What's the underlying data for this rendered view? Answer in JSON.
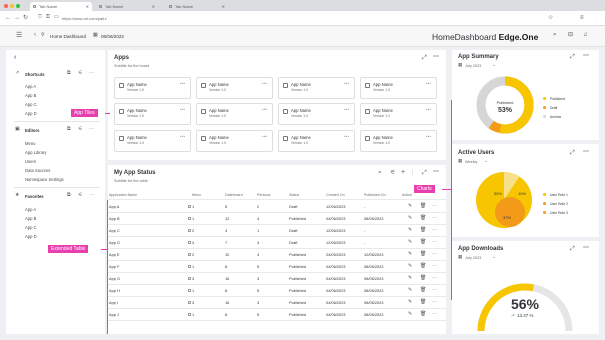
{
  "browser": {
    "tabs": [
      "Tab Name",
      "Tab Name",
      "Tab Name"
    ],
    "url": "https://www.url.com/path/"
  },
  "header": {
    "back": "Home Dashboard",
    "date": "06/06/2022",
    "brand_a": "HomeDashboard",
    "brand_b": "Edge.One"
  },
  "sidebar": {
    "shortcuts": {
      "title": "Shortcuts",
      "items": [
        "App A",
        "App B",
        "App C",
        "App D"
      ]
    },
    "editors": {
      "title": "Editors",
      "items": [
        "Menu",
        "App Library",
        "Users",
        "Data Sources",
        "Namespace Settings"
      ]
    },
    "favorites": {
      "title": "Favorites",
      "items": [
        "App A",
        "App B",
        "App C",
        "App D"
      ]
    }
  },
  "apps": {
    "title": "Apps",
    "subtitle": "Subtitle for the board",
    "tile_name": "App Name",
    "tile_version": "Version 1.0"
  },
  "status": {
    "title": "My App Status",
    "subtitle": "Subtitle for the table",
    "columns": [
      "Application Name",
      "Menu",
      "Dashboard",
      "Persona",
      "Status",
      "Created On",
      "Published On",
      "Action"
    ],
    "rows": [
      [
        "App A",
        "1",
        "5",
        "2",
        "Draft",
        "12/06/2023",
        "-"
      ],
      [
        "App B",
        "1",
        "12",
        "4",
        "Published",
        "04/06/2023",
        "08/06/2023"
      ],
      [
        "App C",
        "2",
        "4",
        "1",
        "Draft",
        "12/06/2023",
        "-"
      ],
      [
        "App D",
        "3",
        "7",
        "3",
        "Draft",
        "12/06/2023",
        "-"
      ],
      [
        "App E",
        "2",
        "10",
        "4",
        "Published",
        "24/05/2023",
        "12/06/2023"
      ],
      [
        "App F",
        "1",
        "8",
        "5",
        "Published",
        "04/06/2023",
        "08/06/2023"
      ],
      [
        "App G",
        "3",
        "16",
        "3",
        "Published",
        "04/06/2023",
        "08/06/2023"
      ],
      [
        "App H",
        "1",
        "8",
        "5",
        "Published",
        "04/06/2023",
        "08/06/2023"
      ],
      [
        "App I",
        "3",
        "16",
        "3",
        "Published",
        "04/06/2023",
        "08/06/2023"
      ],
      [
        "App J",
        "1",
        "8",
        "5",
        "Published",
        "04/06/2023",
        "08/06/2023"
      ]
    ]
  },
  "summary": {
    "title": "App Summary",
    "period": "July 2023",
    "center_label": "Published",
    "center_value": "53%",
    "legend": [
      "Published",
      "Draft",
      "Archive"
    ]
  },
  "active": {
    "title": "Active Users",
    "period": "Weekly",
    "labels": [
      "55%",
      "10%",
      "37%"
    ],
    "legend": [
      "User Role 1",
      "User Role 2",
      "User Role 3"
    ]
  },
  "downloads": {
    "title": "App Downloads",
    "period": "July 2023",
    "value": "56%",
    "delta": "13.37 %",
    "fraction": 0.56
  },
  "callouts": {
    "tiles": "App Tiles",
    "charts": "Charts",
    "table": "Extended Table"
  },
  "colors": {
    "yellow": "#f7c600",
    "orange": "#f39a19",
    "grey": "#d6d6d6",
    "pink": "#e83fae",
    "green": "#2e9e4f"
  }
}
